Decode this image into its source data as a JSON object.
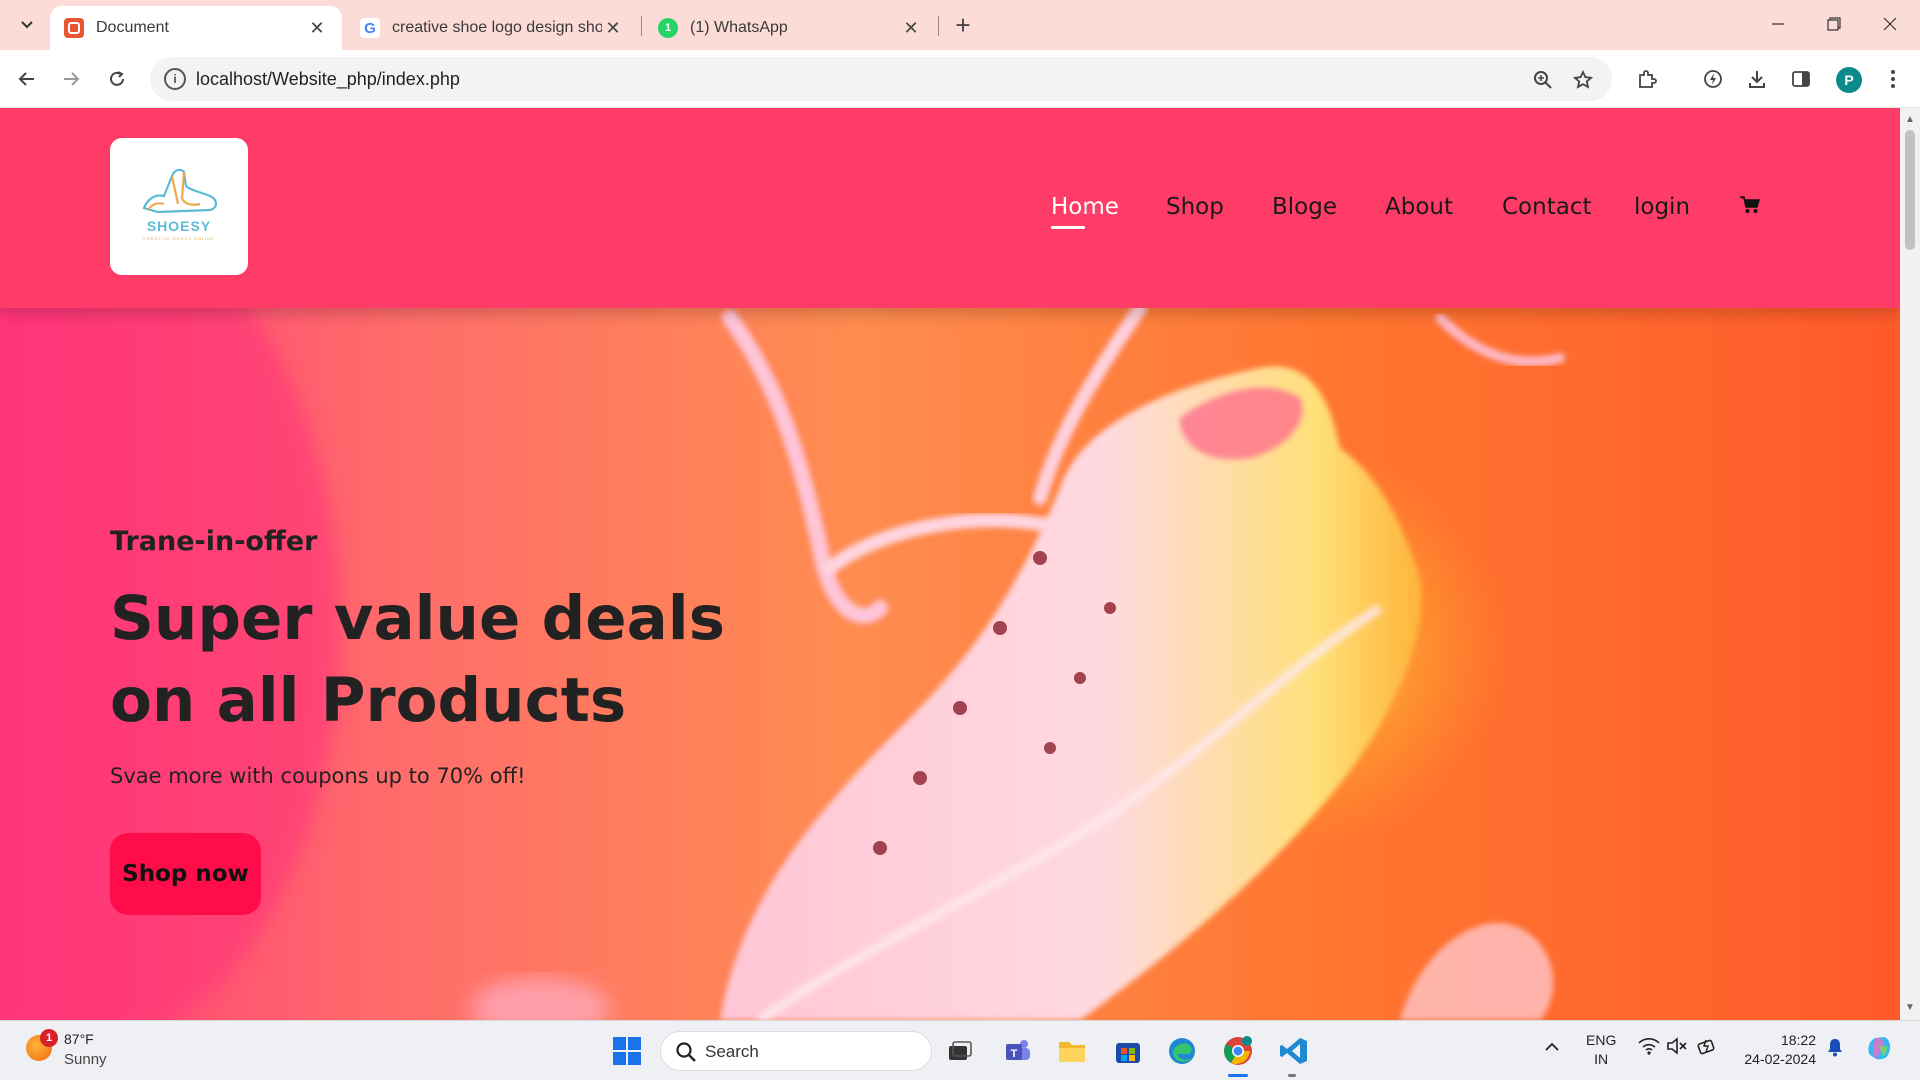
{
  "browser": {
    "tabs": [
      {
        "title": "Document",
        "active": true,
        "favicon_color": "#e8552e"
      },
      {
        "title": "creative shoe logo design shoes",
        "active": false,
        "favicon_color": "#4285f4"
      },
      {
        "title": "(1) WhatsApp",
        "active": false,
        "favicon_color": "#25d366"
      }
    ],
    "favicon_letters": {
      "google": "G",
      "whatsapp": "1"
    },
    "close_glyph": "✕",
    "new_tab_glyph": "+",
    "url": "localhost/Website_php/index.php",
    "profile_initial": "P",
    "icons": [
      "tab-search-icon",
      "back-icon",
      "forward-icon",
      "reload-icon",
      "site-info-icon",
      "zoom-icon",
      "bookmark-star-icon",
      "extensions-icon",
      "performance-icon",
      "download-icon",
      "side-panel-icon",
      "menu-icon",
      "minimize-icon",
      "restore-icon",
      "close-icon"
    ]
  },
  "site": {
    "logo": {
      "name": "SHOESY",
      "tagline": "CREATIVE SHOES ONLINE"
    },
    "nav": [
      {
        "label": "Home",
        "active": true
      },
      {
        "label": "Shop",
        "active": false
      },
      {
        "label": "Bloge",
        "active": false
      },
      {
        "label": "About",
        "active": false
      },
      {
        "label": "Contact",
        "active": false
      },
      {
        "label": "login",
        "active": false
      }
    ],
    "cart_icon": "cart-icon",
    "hero": {
      "eyebrow": "Trane-in-offer",
      "title_line1": "Super value deals",
      "title_line2": "on all Products",
      "subtitle": "Svae more with coupons up to 70% off!",
      "button": "Shop now"
    },
    "colors": {
      "header": "#ff3b67",
      "button": "#ff0d4a",
      "text": "#222222"
    }
  },
  "taskbar": {
    "weather": {
      "temp": "87°F",
      "condition": "Sunny",
      "badge": "1"
    },
    "search_label": "Search",
    "language": {
      "line1": "ENG",
      "line2": "IN"
    },
    "clock": {
      "time": "18:22",
      "date": "24-02-2024"
    },
    "apps": [
      "start-icon",
      "task-view-icon",
      "teams-icon",
      "file-explorer-icon",
      "store-icon",
      "edge-icon",
      "chrome-icon",
      "vscode-icon"
    ]
  }
}
